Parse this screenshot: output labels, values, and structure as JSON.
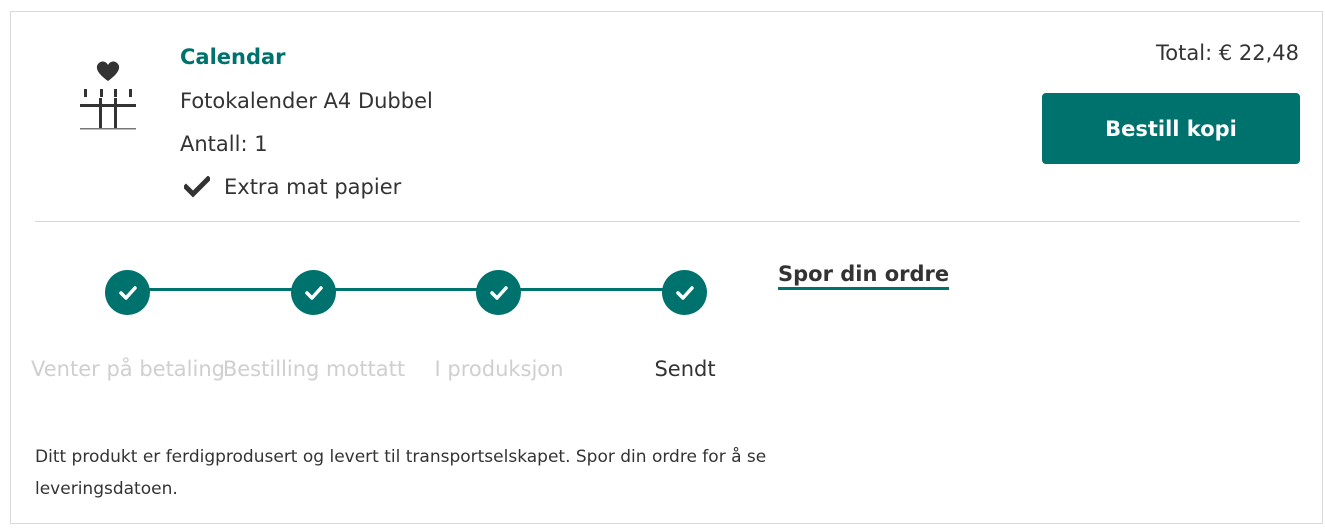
{
  "product": {
    "category": "Calendar",
    "name": "Fotokalender A4 Dubbel",
    "quantity": "Antall: 1",
    "option": "Extra mat papier",
    "icon": "calendar-heart-icon"
  },
  "order": {
    "total": "Total: € 22,48",
    "reorder_label": "Bestill kopi"
  },
  "colors": {
    "accent": "#00726d",
    "inactive_text": "#cfcfcf",
    "text": "#333333"
  },
  "progress": {
    "steps": [
      {
        "label": "Venter på betaling",
        "completed": true,
        "current": false
      },
      {
        "label": "Bestilling mottatt",
        "completed": true,
        "current": false
      },
      {
        "label": "I produksjon",
        "completed": true,
        "current": false
      },
      {
        "label": "Sendt",
        "completed": true,
        "current": true
      }
    ]
  },
  "tracking": {
    "link_label": "Spor din ordre",
    "message": "Ditt produkt er ferdigprodusert og levert til transportselskapet. Spor din ordre for å se leveringsdatoen."
  }
}
